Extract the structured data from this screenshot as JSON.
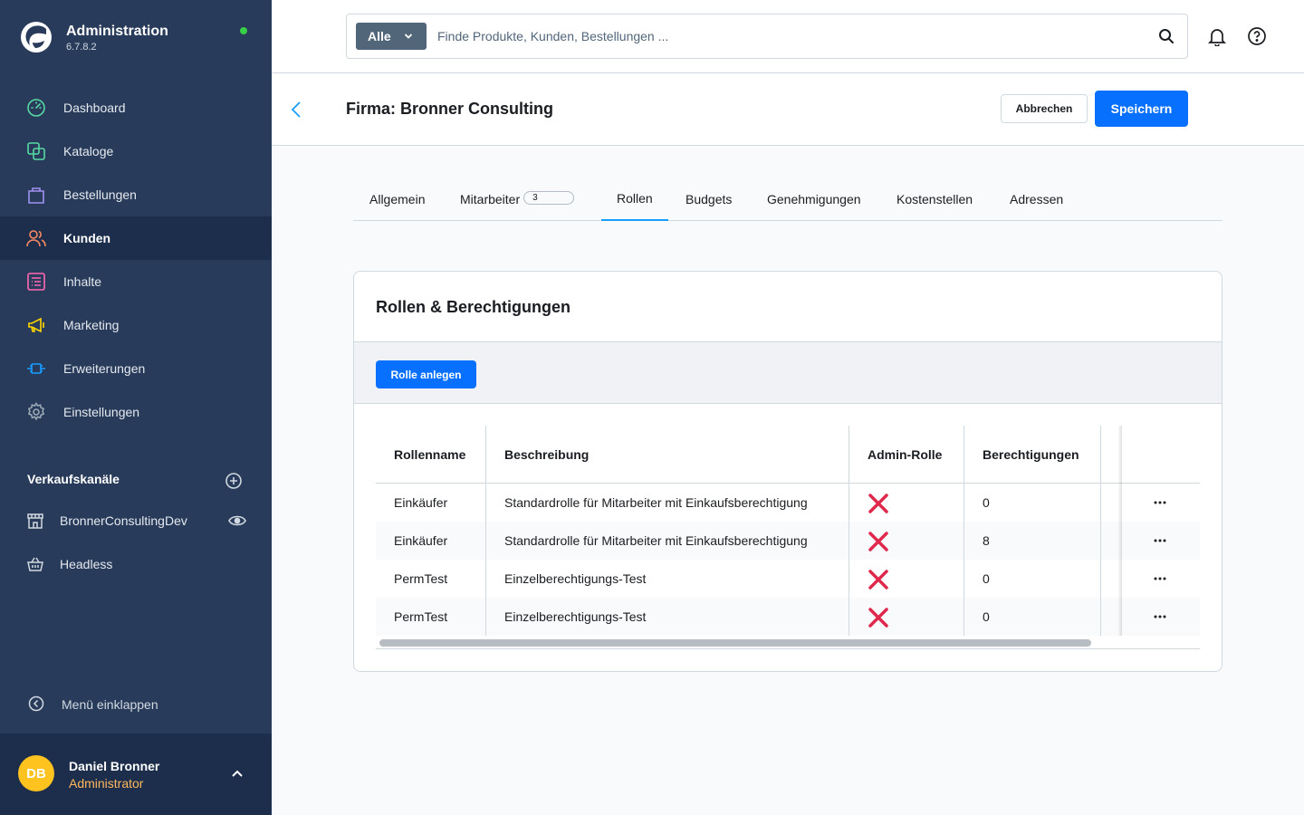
{
  "brand": {
    "title": "Administration",
    "version": "6.7.8.2"
  },
  "nav": [
    {
      "label": "Dashboard",
      "icon": "dashboard-icon",
      "color": "#57d9a3"
    },
    {
      "label": "Kataloge",
      "icon": "catalog-icon",
      "color": "#57d9a3"
    },
    {
      "label": "Bestellungen",
      "icon": "orders-icon",
      "color": "#a092f0"
    },
    {
      "label": "Kunden",
      "icon": "customers-icon",
      "color": "#f88962",
      "active": true
    },
    {
      "label": "Inhalte",
      "icon": "content-icon",
      "color": "#ff68b4"
    },
    {
      "label": "Marketing",
      "icon": "marketing-icon",
      "color": "#ffd700"
    },
    {
      "label": "Erweiterungen",
      "icon": "extensions-icon",
      "color": "#189eff"
    },
    {
      "label": "Einstellungen",
      "icon": "settings-icon",
      "color": "#9aa8b5"
    }
  ],
  "sales_channels": {
    "title": "Verkaufskanäle",
    "items": [
      {
        "label": "BronnerConsultingDev",
        "icon": "storefront-icon"
      },
      {
        "label": "Headless",
        "icon": "basket-icon"
      }
    ]
  },
  "collapse_label": "Menü einklappen",
  "user": {
    "initials": "DB",
    "name": "Daniel Bronner",
    "role": "Administrator"
  },
  "search": {
    "type_label": "Alle",
    "placeholder": "Finde Produkte, Kunden, Bestellungen ..."
  },
  "smartbar": {
    "title": "Firma: Bronner Consulting",
    "cancel_label": "Abbrechen",
    "save_label": "Speichern"
  },
  "tabs": [
    {
      "label": "Allgemein"
    },
    {
      "label": "Mitarbeiter",
      "badge": "3"
    },
    {
      "label": "Rollen",
      "active": true
    },
    {
      "label": "Budgets"
    },
    {
      "label": "Genehmigungen"
    },
    {
      "label": "Kostenstellen"
    },
    {
      "label": "Adressen"
    }
  ],
  "card": {
    "title": "Rollen & Berechtigungen",
    "create_label": "Rolle anlegen",
    "columns": [
      "Rollenname",
      "Beschreibung",
      "Admin-Rolle",
      "Berechtigungen"
    ],
    "rows": [
      {
        "name": "Einkäufer",
        "description": "Standardrolle für Mitarbeiter mit Einkaufsberechtigung",
        "admin": false,
        "permissions": "0"
      },
      {
        "name": "Einkäufer",
        "description": "Standardrolle für Mitarbeiter mit Einkaufsberechtigung",
        "admin": false,
        "permissions": "8"
      },
      {
        "name": "PermTest",
        "description": "Einzelberechtigungs-Test",
        "admin": false,
        "permissions": "0"
      },
      {
        "name": "PermTest",
        "description": "Einzelberechtigungs-Test",
        "admin": false,
        "permissions": "0"
      }
    ]
  },
  "colors": {
    "sidebar": "#293b5a",
    "sidebar_active": "#1c2e4b",
    "primary": "#0870ff",
    "tab_active": "#189eff",
    "cross": "#de294c"
  }
}
